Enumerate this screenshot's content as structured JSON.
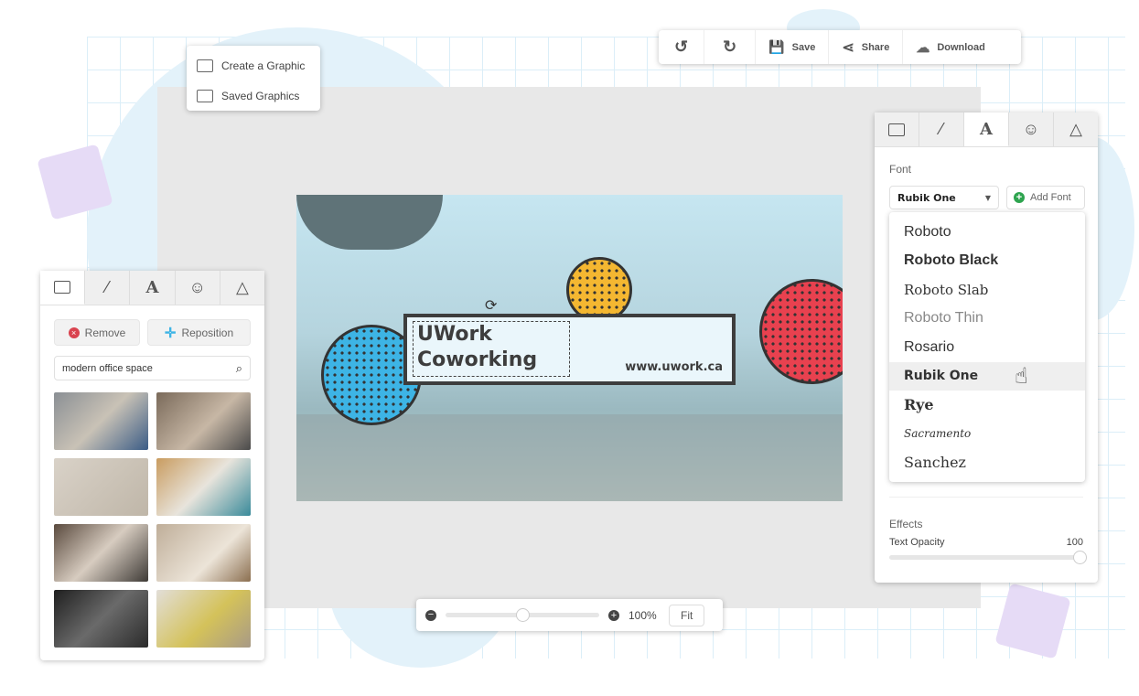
{
  "menu": {
    "items": [
      {
        "label": "Create a Graphic",
        "icon": "image-icon"
      },
      {
        "label": "Saved Graphics",
        "icon": "folder-icon"
      }
    ]
  },
  "toolbar": {
    "undo": "undo-icon",
    "redo": "redo-icon",
    "save": "Save",
    "share": "Share",
    "download": "Download"
  },
  "design": {
    "title_line1": "UWork",
    "title_line2": "Coworking",
    "url": "www.uwork.ca"
  },
  "left_panel": {
    "tabs": [
      "image-icon",
      "magic-wand-icon",
      "A",
      "smiley-icon",
      "triangle-icon"
    ],
    "remove": "Remove",
    "reposition": "Reposition",
    "search_value": "modern office space",
    "thumbs": 8
  },
  "right_panel": {
    "tabs": [
      "image-icon",
      "magic-wand-icon",
      "A",
      "smiley-icon",
      "triangle-icon"
    ],
    "font_label": "Font",
    "font_selected": "Rubik One",
    "add_font": "Add Font",
    "font_options": [
      "Roboto",
      "Roboto Black",
      "Roboto Slab",
      "Roboto Thin",
      "Rosario",
      "Rubik One",
      "Rye",
      "Sacramento",
      "Sanchez"
    ],
    "effects_label": "Effects",
    "opacity_label": "Text Opacity",
    "opacity_value": "100"
  },
  "zoom": {
    "value": "100%",
    "fit": "Fit",
    "level_percent": 50
  },
  "colors": {
    "accent_blue": "#3db4e5",
    "accent_yellow": "#f4b731",
    "accent_red": "#e8414f",
    "add_green": "#2ea44f",
    "remove_red": "#d9434f"
  }
}
